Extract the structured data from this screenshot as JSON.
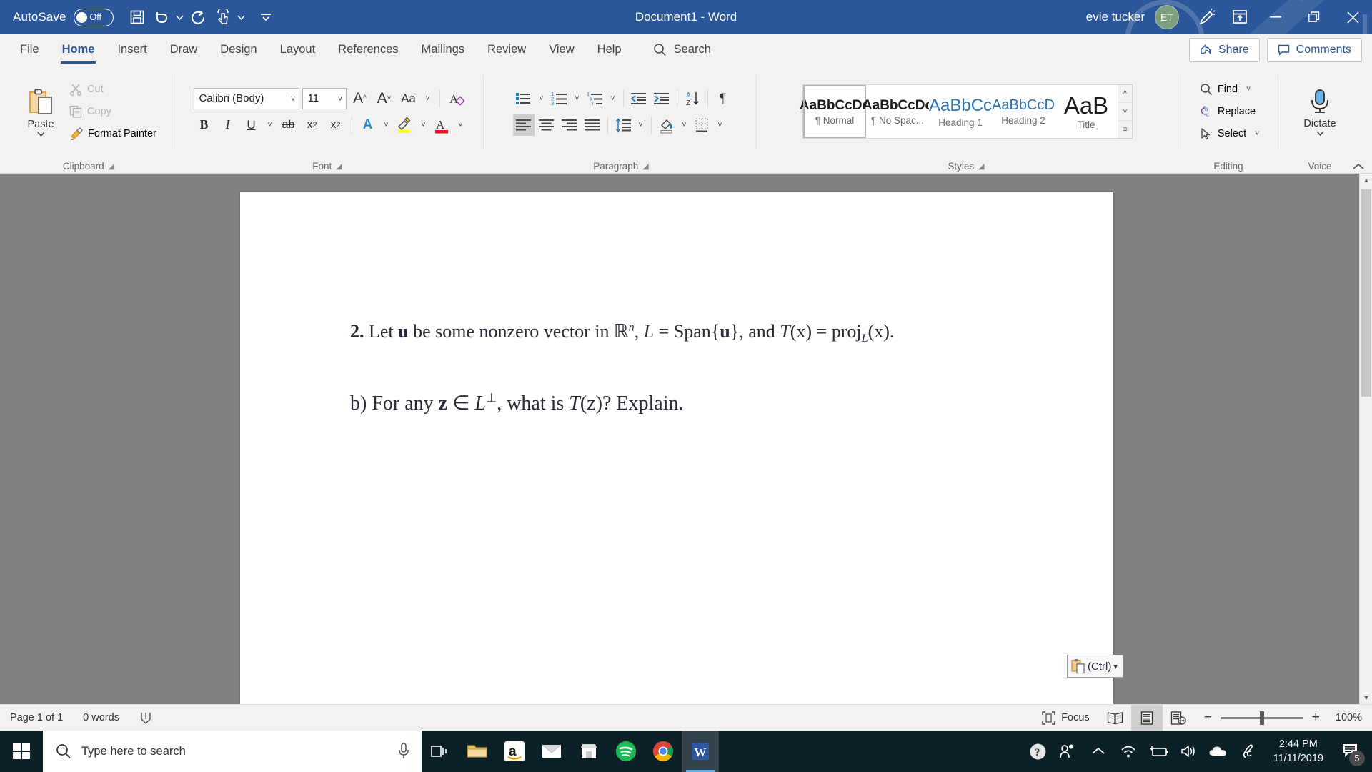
{
  "titlebar": {
    "autosave_label": "AutoSave",
    "autosave_state": "Off",
    "document_title": "Document1  -  Word",
    "user_name": "evie tucker",
    "avatar_initials": "ET",
    "quick_access": [
      "save-icon",
      "undo-icon",
      "redo-icon",
      "touch-mode-icon",
      "customize-qat-icon"
    ],
    "window_controls": [
      "minimize",
      "restore",
      "close"
    ],
    "brand_color": "#2b579a"
  },
  "tabs": [
    {
      "label": "File",
      "active": false
    },
    {
      "label": "Home",
      "active": true
    },
    {
      "label": "Insert",
      "active": false
    },
    {
      "label": "Draw",
      "active": false
    },
    {
      "label": "Design",
      "active": false
    },
    {
      "label": "Layout",
      "active": false
    },
    {
      "label": "References",
      "active": false
    },
    {
      "label": "Mailings",
      "active": false
    },
    {
      "label": "Review",
      "active": false
    },
    {
      "label": "View",
      "active": false
    },
    {
      "label": "Help",
      "active": false
    }
  ],
  "search": {
    "placeholder": "Search",
    "label": "Search"
  },
  "tabstrip_right": {
    "share_label": "Share",
    "comments_label": "Comments"
  },
  "ribbon": {
    "clipboard": {
      "label": "Clipboard",
      "paste_label": "Paste",
      "cut_label": "Cut",
      "copy_label": "Copy",
      "format_painter_label": "Format Painter"
    },
    "font": {
      "label": "Font",
      "font_name": "Calibri (Body)",
      "font_size": "11",
      "grow_font": "A",
      "shrink_font": "A",
      "change_case": "Aa",
      "clear_formatting": "A",
      "bold": "B",
      "italic": "I",
      "underline": "U",
      "strikethrough": "ab",
      "subscript": "x",
      "superscript": "x",
      "text_effects": "A",
      "highlight": "A",
      "font_color": "A"
    },
    "paragraph": {
      "label": "Paragraph",
      "bullets": "bullets-icon",
      "numbering": "numbering-icon",
      "multilevel": "multilevel-list-icon",
      "decrease_indent": "decrease-indent-icon",
      "increase_indent": "increase-indent-icon",
      "sort": "sort-icon",
      "show_marks": "¶",
      "align_left": "align-left-icon",
      "align_center": "align-center-icon",
      "align_right": "align-right-icon",
      "justify": "justify-icon",
      "line_spacing": "line-spacing-icon",
      "shading": "shading-icon",
      "borders": "borders-icon"
    },
    "styles": {
      "label": "Styles",
      "items": [
        {
          "preview": "AaBbCcDc",
          "name": "¶ Normal",
          "selected": true
        },
        {
          "preview": "AaBbCcDc",
          "name": "¶ No Spac...",
          "selected": false
        },
        {
          "preview": "AaBbCс",
          "name": "Heading 1",
          "selected": false
        },
        {
          "preview": "AaBbCcD",
          "name": "Heading 2",
          "selected": false
        },
        {
          "preview": "AaB",
          "name": "Title",
          "selected": false
        }
      ]
    },
    "editing": {
      "label": "Editing",
      "find_label": "Find",
      "replace_label": "Replace",
      "select_label": "Select"
    },
    "voice": {
      "label": "Voice",
      "dictate_label": "Dictate"
    }
  },
  "document": {
    "line1": {
      "number": "2.",
      "text_before_u": "Let ",
      "u": "u",
      "text_mid": " be some nonzero vector in ",
      "rn": "ℝ",
      "rn_sup": "n",
      "comma": ", ",
      "L": "L",
      "eq1": " = Span{",
      "u2": "u",
      "close": "}, and ",
      "T": "T",
      "x1": "(x) = proj",
      "sub_L": "L",
      "x2": "(x)."
    },
    "line2": {
      "label": "b)",
      "text": " For any ",
      "z": "z",
      "elem": " ∈ ",
      "L": "L",
      "perp": "⊥",
      "rest": ", what is ",
      "T": "T",
      "z2": "(z)? Explain."
    },
    "paste_options": {
      "label": "(Ctrl)",
      "icon": "clipboard-icon",
      "caret": "▾"
    }
  },
  "statusbar": {
    "page": "Page 1 of 1",
    "words": "0 words",
    "proofing_icon": "proofing-icon",
    "focus_label": "Focus",
    "view_read": "read-mode-icon",
    "view_print": "print-layout-icon",
    "view_web": "web-layout-icon",
    "zoom_out": "−",
    "zoom_in": "+",
    "zoom_level": "100%"
  },
  "taskbar": {
    "search_placeholder": "Type here to search",
    "apps": [
      {
        "name": "task-view-icon"
      },
      {
        "name": "file-explorer-icon"
      },
      {
        "name": "amazon-icon"
      },
      {
        "name": "mail-icon"
      },
      {
        "name": "microsoft-store-icon"
      },
      {
        "name": "spotify-icon"
      },
      {
        "name": "chrome-icon"
      },
      {
        "name": "word-icon",
        "active": true
      }
    ],
    "tray": [
      "help-icon",
      "people-icon",
      "show-hidden-icons-icon",
      "network-icon",
      "battery-icon",
      "volume-icon",
      "onedrive-icon",
      "pen-icon"
    ],
    "time": "2:44 PM",
    "date": "11/11/2019",
    "notification_count": "5"
  }
}
